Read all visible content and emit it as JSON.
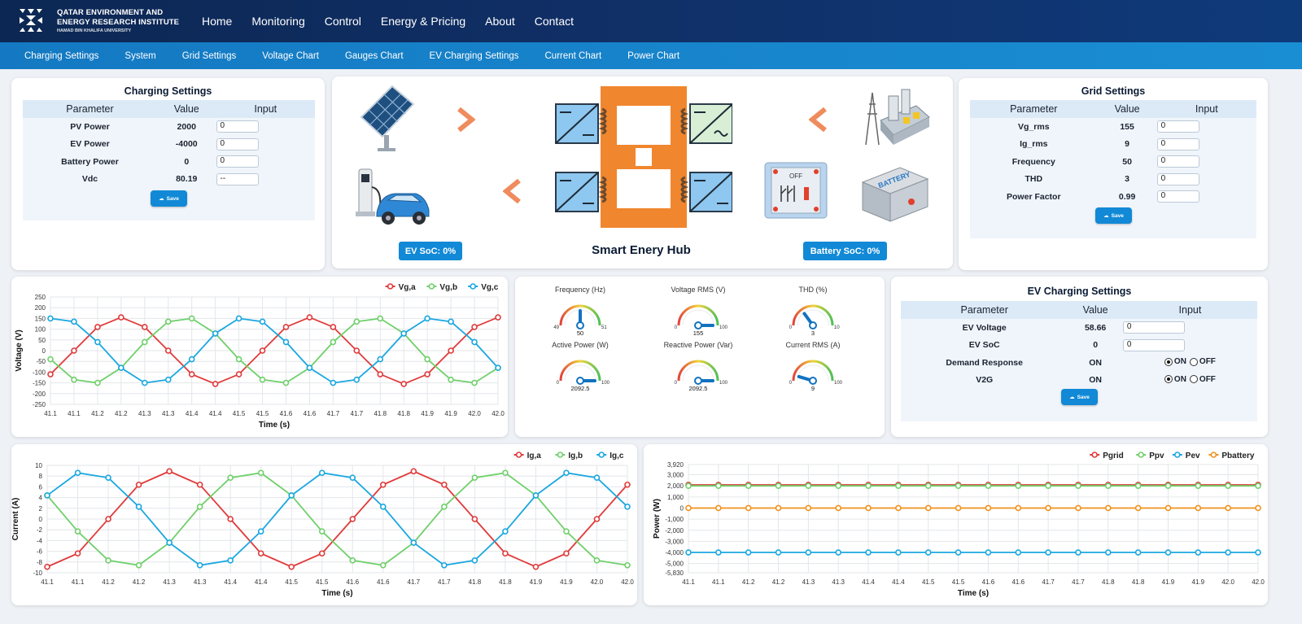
{
  "header": {
    "org_line1": "QATAR ENVIRONMENT AND",
    "org_line2": "ENERGY RESEARCH INSTITUTE",
    "org_line3": "HAMAD BIN KHALIFA UNIVERSITY",
    "nav": [
      "Home",
      "Monitoring",
      "Control",
      "Energy & Pricing",
      "About",
      "Contact"
    ]
  },
  "subnav": [
    "Charging Settings",
    "System",
    "Grid Settings",
    "Voltage Chart",
    "Gauges Chart",
    "EV Charging Settings",
    "Current Chart",
    "Power Chart"
  ],
  "charging_settings": {
    "title": "Charging Settings",
    "columns": [
      "Parameter",
      "Value",
      "Input"
    ],
    "rows": [
      {
        "param": "PV Power",
        "value": "2000",
        "input": "0"
      },
      {
        "param": "EV Power",
        "value": "-4000",
        "input": "0"
      },
      {
        "param": "Battery Power",
        "value": "0",
        "input": "0"
      },
      {
        "param": "Vdc",
        "value": "80.19",
        "input": "--"
      }
    ],
    "save_label": "Save"
  },
  "hub": {
    "title": "Smart Enery Hub",
    "ev_soc": "EV SoC: 0%",
    "battery_soc": "Battery SoC: 0%",
    "switch_label": "OFF",
    "battery_label": "BATTERY"
  },
  "grid_settings": {
    "title": "Grid Settings",
    "columns": [
      "Parameter",
      "Value",
      "Input"
    ],
    "rows": [
      {
        "param": "Vg_rms",
        "value": "155",
        "input": "0"
      },
      {
        "param": "Ig_rms",
        "value": "9",
        "input": "0"
      },
      {
        "param": "Frequency",
        "value": "50",
        "input": "0"
      },
      {
        "param": "THD",
        "value": "3",
        "input": "0"
      },
      {
        "param": "Power Factor",
        "value": "0.99",
        "input": "0"
      }
    ],
    "save_label": "Save"
  },
  "gauges": [
    {
      "label": "Frequency (Hz)",
      "value": "50",
      "min": "49",
      "max": "51",
      "level": 0.5
    },
    {
      "label": "Voltage RMS (V)",
      "value": "155",
      "min": "0",
      "max": "100",
      "level": 1.0
    },
    {
      "label": "THD (%)",
      "value": "3",
      "min": "0",
      "max": "10",
      "level": 0.3
    },
    {
      "label": "Active Power (W)",
      "value": "2092.5",
      "min": "0",
      "max": "100",
      "level": 1.0
    },
    {
      "label": "Reactive Power (Var)",
      "value": "2092.5",
      "min": "0",
      "max": "100",
      "level": 1.0
    },
    {
      "label": "Current RMS (A)",
      "value": "9",
      "min": "0",
      "max": "100",
      "level": 0.09
    }
  ],
  "ev_settings": {
    "title": "EV Charging Settings",
    "columns": [
      "Parameter",
      "Value",
      "Input"
    ],
    "rows": [
      {
        "param": "EV Voltage",
        "value": "58.66",
        "input": "0"
      },
      {
        "param": "EV SoC",
        "value": "0",
        "input": "0"
      }
    ],
    "radio_rows": [
      {
        "param": "Demand Response",
        "value": "ON",
        "on": "ON",
        "off": "OFF"
      },
      {
        "param": "V2G",
        "value": "ON",
        "on": "ON",
        "off": "OFF"
      }
    ],
    "save_label": "Save"
  },
  "chart_data": [
    {
      "type": "line",
      "x": [
        "41.1",
        "41.1",
        "41.2",
        "41.2",
        "41.3",
        "41.3",
        "41.4",
        "41.4",
        "41.5",
        "41.5",
        "41.6",
        "41.6",
        "41.7",
        "41.7",
        "41.8",
        "41.8",
        "41.9",
        "41.9",
        "42.0",
        "42.0"
      ],
      "xlabel": "Time (s)",
      "ylabel": "Voltage (V)",
      "ylim": [
        -250,
        250
      ],
      "yticks": [
        250,
        200,
        150,
        100,
        50,
        0,
        -50,
        -100,
        -150,
        -200,
        -250
      ],
      "series": [
        {
          "name": "Vg,a",
          "color": "#e03a3a",
          "values": [
            -110,
            0,
            110,
            155,
            110,
            0,
            -110,
            -155,
            -110,
            0,
            110,
            155,
            110,
            0,
            -110,
            -155,
            -110,
            0,
            110,
            155
          ]
        },
        {
          "name": "Vg,b",
          "color": "#6fd06a",
          "values": [
            -40,
            -135,
            -150,
            -80,
            40,
            135,
            150,
            80,
            -40,
            -135,
            -150,
            -80,
            40,
            135,
            150,
            80,
            -40,
            -135,
            -150,
            -80
          ]
        },
        {
          "name": "Vg,c",
          "color": "#1aa7e0",
          "values": [
            150,
            135,
            40,
            -80,
            -150,
            -135,
            -40,
            80,
            150,
            135,
            40,
            -80,
            -150,
            -135,
            -40,
            80,
            150,
            135,
            40,
            -80
          ]
        }
      ],
      "legend": "top-right",
      "grid": true
    },
    {
      "type": "line",
      "x": [
        "41.1",
        "41.1",
        "41.2",
        "41.2",
        "41.3",
        "41.3",
        "41.4",
        "41.4",
        "41.5",
        "41.5",
        "41.6",
        "41.6",
        "41.7",
        "41.7",
        "41.8",
        "41.8",
        "41.9",
        "41.9",
        "42.0",
        "42.0"
      ],
      "xlabel": "Time (s)",
      "ylabel": "Current (A)",
      "ylim": [
        -10,
        10
      ],
      "yticks": [
        10,
        8,
        6,
        4,
        2,
        0,
        -2,
        -4,
        -6,
        -8,
        -10
      ],
      "series": [
        {
          "name": "Ig,a",
          "color": "#e03a3a",
          "values": [
            -8.9,
            -6.4,
            0,
            6.4,
            8.9,
            6.4,
            0,
            -6.4,
            -8.9,
            -6.4,
            0,
            6.4,
            8.9,
            6.4,
            0,
            -6.4,
            -8.9,
            -6.4,
            0,
            6.4
          ]
        },
        {
          "name": "Ig,b",
          "color": "#6fd06a",
          "values": [
            4.4,
            -2.3,
            -7.7,
            -8.6,
            -4.4,
            2.3,
            7.7,
            8.6,
            4.4,
            -2.3,
            -7.7,
            -8.6,
            -4.4,
            2.3,
            7.7,
            8.6,
            4.4,
            -2.3,
            -7.7,
            -8.6
          ]
        },
        {
          "name": "Ig,c",
          "color": "#1aa7e0",
          "values": [
            4.4,
            8.6,
            7.7,
            2.3,
            -4.4,
            -8.6,
            -7.7,
            -2.3,
            4.4,
            8.6,
            7.7,
            2.3,
            -4.4,
            -8.6,
            -7.7,
            -2.3,
            4.4,
            8.6,
            7.7,
            2.3
          ]
        }
      ],
      "legend": "top-right",
      "grid": true
    },
    {
      "type": "line",
      "x": [
        "41.1",
        "41.1",
        "41.2",
        "41.2",
        "41.3",
        "41.3",
        "41.4",
        "41.4",
        "41.5",
        "41.5",
        "41.6",
        "41.6",
        "41.7",
        "41.7",
        "41.8",
        "41.8",
        "41.9",
        "41.9",
        "42.0",
        "42.0"
      ],
      "xlabel": "Time (s)",
      "ylabel": "Power (W)",
      "ylim": [
        -5830,
        3920
      ],
      "yticks": [
        "3,920",
        "3,000",
        "2,000",
        "1,000",
        "0",
        "-1,000",
        "-2,000",
        "-3,000",
        "-4,000",
        "-5,000",
        "-5,830"
      ],
      "ytick_values": [
        3920,
        3000,
        2000,
        1000,
        0,
        -1000,
        -2000,
        -3000,
        -4000,
        -5000,
        -5830
      ],
      "series": [
        {
          "name": "Pgrid",
          "color": "#e03a3a",
          "values": [
            2090,
            2090,
            2090,
            2090,
            2090,
            2090,
            2090,
            2090,
            2090,
            2090,
            2090,
            2090,
            2090,
            2090,
            2090,
            2090,
            2090,
            2090,
            2090,
            2090
          ]
        },
        {
          "name": "Ppv",
          "color": "#6fd06a",
          "values": [
            2000,
            2000,
            2000,
            2000,
            2000,
            2000,
            2000,
            2000,
            2000,
            2000,
            2000,
            2000,
            2000,
            2000,
            2000,
            2000,
            2000,
            2000,
            2000,
            2000
          ]
        },
        {
          "name": "Pev",
          "color": "#1aa7e0",
          "values": [
            -4000,
            -4000,
            -4000,
            -4000,
            -4000,
            -4000,
            -4000,
            -4000,
            -4000,
            -4000,
            -4000,
            -4000,
            -4000,
            -4000,
            -4000,
            -4000,
            -4000,
            -4000,
            -4000,
            -4000
          ]
        },
        {
          "name": "Pbattery",
          "color": "#f0921e",
          "values": [
            0,
            0,
            0,
            0,
            0,
            0,
            0,
            0,
            0,
            0,
            0,
            0,
            0,
            0,
            0,
            0,
            0,
            0,
            0,
            0
          ]
        }
      ],
      "legend": "top-right",
      "grid": true
    }
  ]
}
